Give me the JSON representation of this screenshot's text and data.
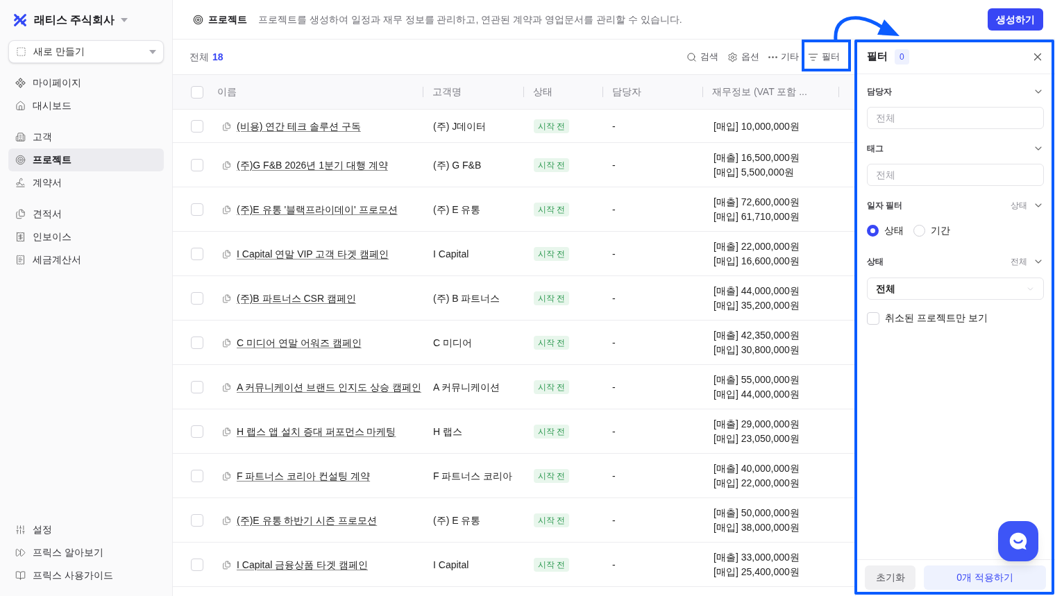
{
  "sidebar": {
    "company": "래티스 주식회사",
    "new_button": "새로 만들기",
    "nav_groups": [
      {
        "items": [
          {
            "label": "마이페이지",
            "selected": false
          },
          {
            "label": "대시보드",
            "selected": false
          }
        ]
      },
      {
        "items": [
          {
            "label": "고객",
            "selected": false
          },
          {
            "label": "프로젝트",
            "selected": true
          },
          {
            "label": "계약서",
            "selected": false
          }
        ]
      },
      {
        "items": [
          {
            "label": "견적서",
            "selected": false
          },
          {
            "label": "인보이스",
            "selected": false
          },
          {
            "label": "세금계산서",
            "selected": false
          }
        ]
      }
    ],
    "bottom_items": [
      "설정",
      "프릭스 알아보기",
      "프릭스 사용가이드"
    ]
  },
  "header": {
    "title": "프로젝트",
    "description": "프로젝트를 생성하여 일정과 재무 정보를 관리하고, 연관된 계약과 영업문서를 관리할 수 있습니다.",
    "create_button": "생성하기"
  },
  "toolbar": {
    "total_label": "전체",
    "total_count": "18",
    "actions": [
      "검색",
      "옵션",
      "기타",
      "필터"
    ]
  },
  "table": {
    "header_checked": false,
    "columns": [
      "이름",
      "고객명",
      "상태",
      "담당자",
      "재무정보 (VAT 포함 ..."
    ],
    "rows": [
      {
        "checked": false,
        "name": "(비용) 연간 테크 솔루션 구독",
        "customer": "(주) J데이터",
        "status": "시작 전",
        "manager": "-",
        "finance": [
          "[매입] 10,000,000원"
        ]
      },
      {
        "checked": false,
        "name": "(주)G F&B 2026년 1분기 대행 계약",
        "customer": "(주) G F&B",
        "status": "시작 전",
        "manager": "-",
        "finance": [
          "[매출] 16,500,000원",
          "[매입] 5,500,000원"
        ]
      },
      {
        "checked": false,
        "name": "(주)E 유통 '블랙프라이데이' 프로모션",
        "customer": "(주) E 유통",
        "status": "시작 전",
        "manager": "-",
        "finance": [
          "[매출] 72,600,000원",
          "[매입] 61,710,000원"
        ]
      },
      {
        "checked": false,
        "name": "I Capital 연말 VIP 고객 타겟 캠페인",
        "customer": "I Capital",
        "status": "시작 전",
        "manager": "-",
        "finance": [
          "[매출] 22,000,000원",
          "[매입] 16,600,000원"
        ]
      },
      {
        "checked": false,
        "name": "(주)B 파트너스 CSR 캠페인",
        "customer": "(주) B 파트너스",
        "status": "시작 전",
        "manager": "-",
        "finance": [
          "[매출] 44,000,000원",
          "[매입] 35,200,000원"
        ]
      },
      {
        "checked": false,
        "name": "C 미디어 연말 어워즈 캠페인",
        "customer": "C 미디어",
        "status": "시작 전",
        "manager": "-",
        "finance": [
          "[매출] 42,350,000원",
          "[매입] 30,800,000원"
        ]
      },
      {
        "checked": false,
        "name": "A 커뮤니케이션 브랜드 인지도 상승 캠페인",
        "customer": "A 커뮤니케이션",
        "status": "시작 전",
        "manager": "-",
        "finance": [
          "[매출] 55,000,000원",
          "[매입] 44,000,000원"
        ]
      },
      {
        "checked": false,
        "name": "H 랩스 앱 설치 증대 퍼포먼스 마케팅",
        "customer": "H 랩스",
        "status": "시작 전",
        "manager": "-",
        "finance": [
          "[매출] 29,000,000원",
          "[매입] 23,050,000원"
        ]
      },
      {
        "checked": false,
        "name": "F 파트너스 코리아 컨설팅 계약",
        "customer": "F 파트너스 코리아",
        "status": "시작 전",
        "manager": "-",
        "finance": [
          "[매출] 40,000,000원",
          "[매입] 22,000,000원"
        ]
      },
      {
        "checked": false,
        "name": "(주)E 유통 하반기 시즌 프로모션",
        "customer": "(주) E 유통",
        "status": "시작 전",
        "manager": "-",
        "finance": [
          "[매출] 50,000,000원",
          "[매입] 38,000,000원"
        ]
      },
      {
        "checked": false,
        "name": "I Capital 금융상품 타겟 캠페인",
        "customer": "I Capital",
        "status": "시작 전",
        "manager": "-",
        "finance": [
          "[매출] 33,000,000원",
          "[매입] 25,400,000원"
        ]
      }
    ]
  },
  "filter_panel": {
    "title": "필터",
    "count": "0",
    "sections": [
      {
        "kind": "input",
        "label": "담당자",
        "placeholder": "전체"
      },
      {
        "kind": "input",
        "label": "태그",
        "placeholder": "전체"
      },
      {
        "kind": "radio",
        "label": "일자 필터",
        "summary": "상태",
        "options": [
          {
            "label": "상태",
            "selected": true
          },
          {
            "label": "기간",
            "selected": false
          }
        ]
      },
      {
        "kind": "select",
        "label": "상태",
        "summary": "전체",
        "value": "전체"
      }
    ],
    "cancelled_only": {
      "label": "취소된 프로젝트만 보기",
      "checked": false
    },
    "reset_button": "초기화",
    "apply_button": "0개 적용하기"
  }
}
